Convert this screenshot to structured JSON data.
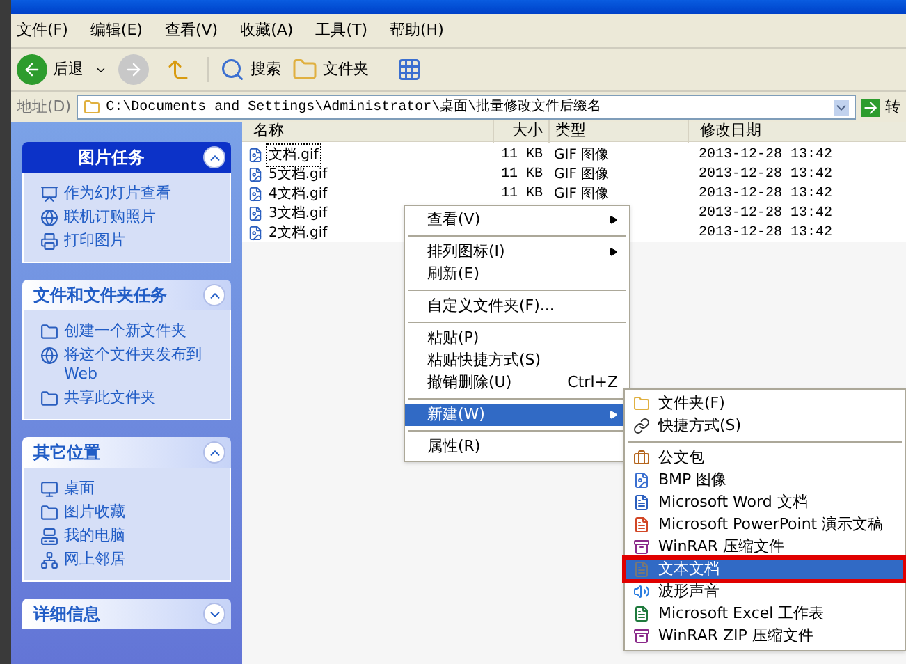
{
  "menu_bar": [
    {
      "label": "文件(F)"
    },
    {
      "label": "编辑(E)"
    },
    {
      "label": "查看(V)"
    },
    {
      "label": "收藏(A)"
    },
    {
      "label": "工具(T)"
    },
    {
      "label": "帮助(H)"
    }
  ],
  "toolbar": {
    "back": "后退",
    "search": "搜索",
    "folders": "文件夹"
  },
  "address_bar": {
    "label": "地址(D)",
    "value": "C:\\Documents and Settings\\Administrator\\桌面\\批量修改文件后缀名",
    "go": "转"
  },
  "sidebar": [
    {
      "title": "图片任务",
      "kind": "special",
      "expanded": true,
      "items": [
        {
          "label": "作为幻灯片查看"
        },
        {
          "label": "联机订购照片"
        },
        {
          "label": "打印图片"
        }
      ]
    },
    {
      "title": "文件和文件夹任务",
      "kind": "normal",
      "expanded": true,
      "items": [
        {
          "label": "创建一个新文件夹"
        },
        {
          "label": "将这个文件夹发布到\nWeb"
        },
        {
          "label": "共享此文件夹"
        }
      ]
    },
    {
      "title": "其它位置",
      "kind": "normal",
      "expanded": true,
      "items": [
        {
          "label": "桌面"
        },
        {
          "label": "图片收藏"
        },
        {
          "label": "我的电脑"
        },
        {
          "label": "网上邻居"
        }
      ]
    },
    {
      "title": "详细信息",
      "kind": "normal",
      "expanded": false
    }
  ],
  "table": {
    "columns": [
      "名称",
      "大小",
      "类型",
      "修改日期"
    ],
    "rows": [
      {
        "name": "文档.gif",
        "size": "11 KB",
        "type": "GIF 图像",
        "modified": "2013-12-28 13:42",
        "focused": true
      },
      {
        "name": "5文档.gif",
        "size": "11 KB",
        "type": "GIF 图像",
        "modified": "2013-12-28 13:42",
        "focused": false
      },
      {
        "name": "4文档.gif",
        "size": "11 KB",
        "type": "GIF 图像",
        "modified": "2013-12-28 13:42",
        "focused": false
      },
      {
        "name": "3文档.gif",
        "modified": "2013-12-28 13:42",
        "focused": false
      },
      {
        "name": "2文档.gif",
        "modified": "2013-12-28 13:42",
        "focused": false
      }
    ]
  },
  "context_menu": [
    {
      "kind": "item",
      "label": "查看(V)",
      "submenu": true,
      "selected": false
    },
    {
      "kind": "separator"
    },
    {
      "kind": "item",
      "label": "排列图标(I)",
      "submenu": true,
      "selected": false
    },
    {
      "kind": "item",
      "label": "刷新(E)",
      "submenu": false,
      "selected": false
    },
    {
      "kind": "separator"
    },
    {
      "kind": "item",
      "label": "自定义文件夹(F)...",
      "submenu": false,
      "selected": false
    },
    {
      "kind": "separator"
    },
    {
      "kind": "item",
      "label": "粘贴(P)",
      "submenu": false,
      "selected": false
    },
    {
      "kind": "item",
      "label": "粘贴快捷方式(S)",
      "submenu": false,
      "selected": false
    },
    {
      "kind": "item",
      "label": "撤销删除(U)",
      "shortcut": "Ctrl+Z",
      "submenu": false,
      "selected": false
    },
    {
      "kind": "separator"
    },
    {
      "kind": "item",
      "label": "新建(W)",
      "submenu": true,
      "selected": true
    },
    {
      "kind": "separator"
    },
    {
      "kind": "item",
      "label": "属性(R)",
      "submenu": false,
      "selected": false
    }
  ],
  "new_submenu": [
    {
      "kind": "item",
      "label": "文件夹(F)",
      "selected": false,
      "annotated": false
    },
    {
      "kind": "item",
      "label": "快捷方式(S)",
      "selected": false,
      "annotated": false
    },
    {
      "kind": "separator"
    },
    {
      "kind": "item",
      "label": "公文包",
      "selected": false,
      "annotated": false
    },
    {
      "kind": "item",
      "label": "BMP 图像",
      "selected": false,
      "annotated": false
    },
    {
      "kind": "item",
      "label": "Microsoft Word 文档",
      "selected": false,
      "annotated": false
    },
    {
      "kind": "item",
      "label": "Microsoft PowerPoint 演示文稿",
      "selected": false,
      "annotated": false
    },
    {
      "kind": "item",
      "label": "WinRAR 压缩文件",
      "selected": false,
      "annotated": false
    },
    {
      "kind": "item",
      "label": "文本文档",
      "selected": true,
      "annotated": true
    },
    {
      "kind": "item",
      "label": "波形声音",
      "selected": false,
      "annotated": false
    },
    {
      "kind": "item",
      "label": "Microsoft Excel 工作表",
      "selected": false,
      "annotated": false
    },
    {
      "kind": "item",
      "label": "WinRAR ZIP 压缩文件",
      "selected": false,
      "annotated": false
    }
  ]
}
